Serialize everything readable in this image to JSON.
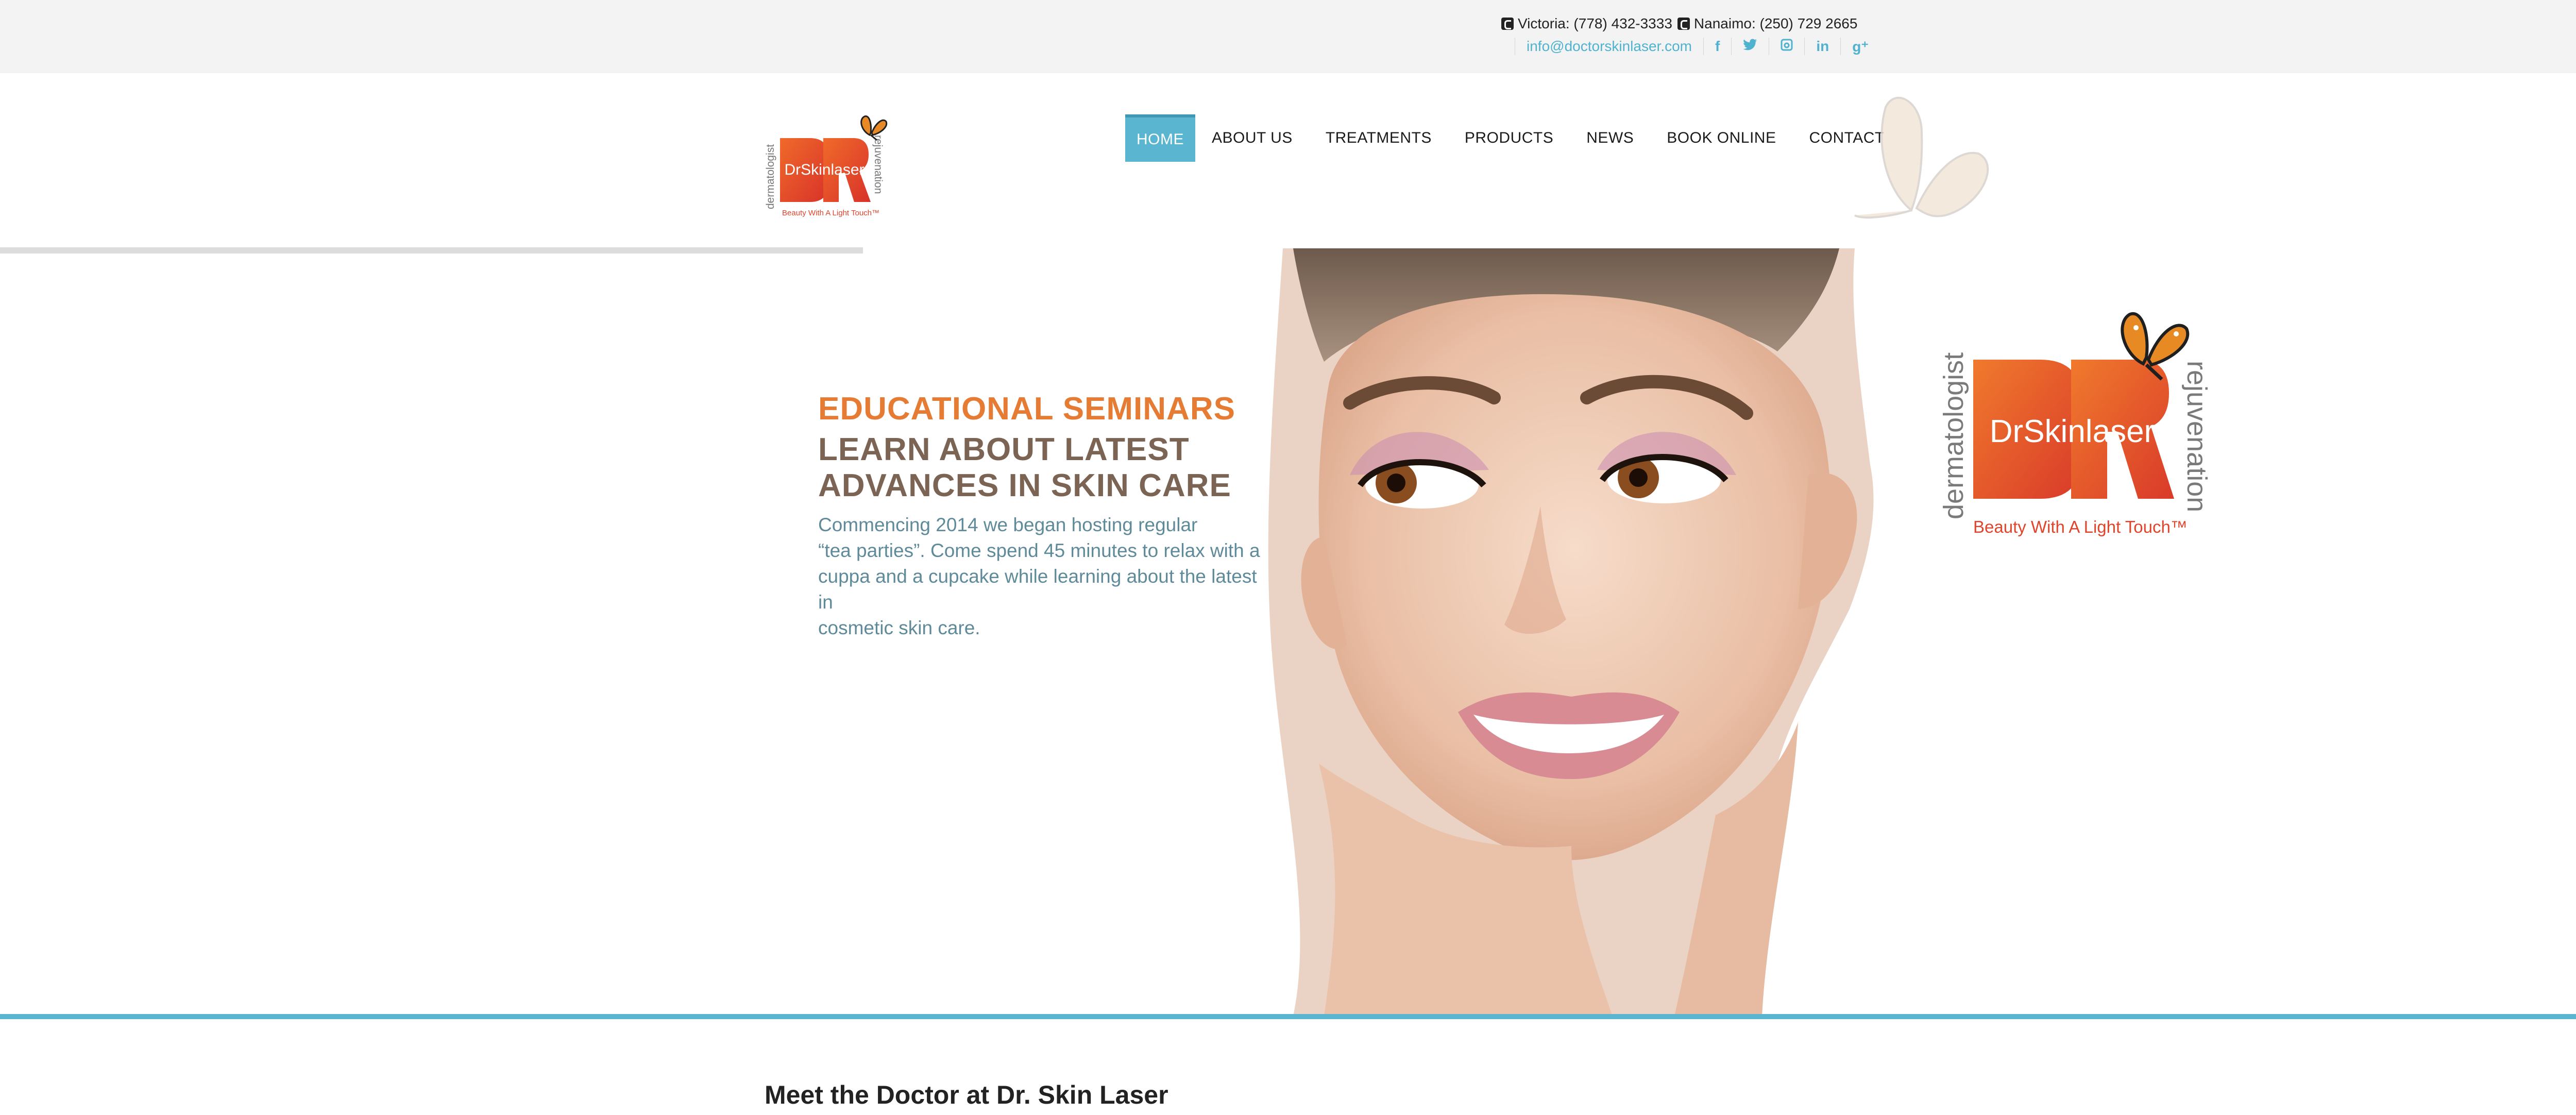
{
  "topbar": {
    "victoria": "Victoria: (778) 432-3333",
    "nanaimo": "Nanaimo: (250) 729 2665",
    "email": "info@doctorskinlaser.com",
    "social": [
      {
        "icon": "facebook-icon",
        "glyph": "f"
      },
      {
        "icon": "twitter-icon",
        "glyph": "t"
      },
      {
        "icon": "instagram-icon",
        "glyph": "◘"
      },
      {
        "icon": "linkedin-icon",
        "glyph": "in"
      },
      {
        "icon": "google-plus-icon",
        "glyph": "g⁺"
      }
    ]
  },
  "logo": {
    "brand": "DrSkinlaser",
    "left_text": "dermatologist",
    "right_text": "rejuvenation",
    "tagline": "Beauty With A Light Touch™"
  },
  "nav": {
    "items": [
      "HOME",
      "ABOUT US",
      "TREATMENTS",
      "PRODUCTS",
      "NEWS",
      "BOOK ONLINE",
      "CONTACT"
    ],
    "active": "HOME"
  },
  "hero": {
    "kicker": "EDUCATIONAL SEMINARS",
    "title_line1": "LEARN ABOUT LATEST",
    "title_line2": "ADVANCES IN SKIN CARE",
    "body_line1": "Commencing 2014 we began hosting regular",
    "body_line2": "“tea parties”. Come spend 45 minutes to relax with a",
    "body_line3": "cuppa and a cupcake while learning about the latest in",
    "body_line4": "cosmetic skin care."
  },
  "section": {
    "meet_title": "Meet the Doctor at Dr. Skin Laser"
  },
  "colors": {
    "accent_blue": "#5ab6d0",
    "brand_orange": "#e67b33",
    "heading_brown": "#7b6453",
    "body_text": "#5e8a9a",
    "logo_red": "#e0452c"
  }
}
